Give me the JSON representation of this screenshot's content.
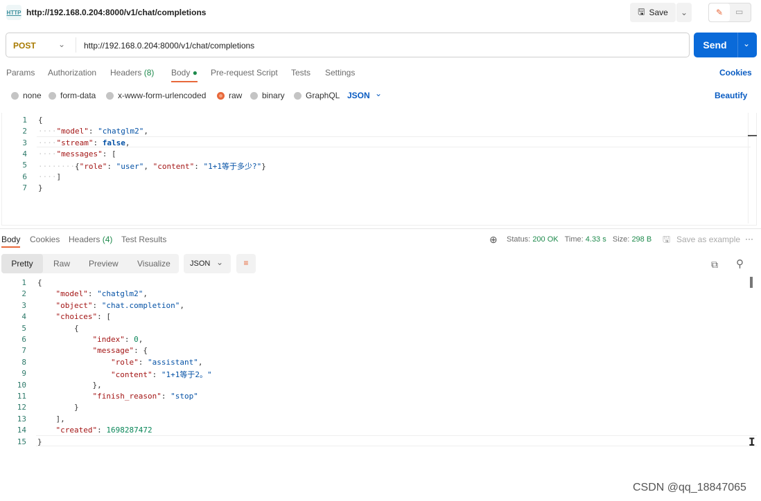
{
  "header": {
    "title": "http://192.168.0.204:8000/v1/chat/completions",
    "icon": "http-icon",
    "save_label": "Save"
  },
  "request": {
    "method": "POST",
    "url": "http://192.168.0.204:8000/v1/chat/completions",
    "send_label": "Send",
    "tabs": [
      {
        "label": "Params"
      },
      {
        "label": "Authorization"
      },
      {
        "label": "Headers",
        "count": "(8)"
      },
      {
        "label": "Body"
      },
      {
        "label": "Pre-request Script"
      },
      {
        "label": "Tests"
      },
      {
        "label": "Settings"
      }
    ],
    "cookies_label": "Cookies",
    "body_types": [
      "none",
      "form-data",
      "x-www-form-urlencoded",
      "raw",
      "binary",
      "GraphQL"
    ],
    "selected_body_type": "raw",
    "format": "JSON",
    "beautify_label": "Beautify",
    "code": [
      [
        [
          "p",
          "{"
        ]
      ],
      [
        [
          "w",
          "····"
        ],
        [
          "k",
          "\"model\""
        ],
        [
          "p",
          ": "
        ],
        [
          "s",
          "\"chatglm2\""
        ],
        [
          "p",
          ","
        ]
      ],
      [
        [
          "w",
          "····"
        ],
        [
          "k",
          "\"stream\""
        ],
        [
          "p",
          ": "
        ],
        [
          "b",
          "false"
        ],
        [
          "p",
          ","
        ]
      ],
      [
        [
          "w",
          "····"
        ],
        [
          "k",
          "\"messages\""
        ],
        [
          "p",
          ": ["
        ]
      ],
      [
        [
          "w",
          "········"
        ],
        [
          "p",
          "{"
        ],
        [
          "k",
          "\"role\""
        ],
        [
          "p",
          ": "
        ],
        [
          "s",
          "\"user\""
        ],
        [
          "p",
          ", "
        ],
        [
          "k",
          "\"content\""
        ],
        [
          "p",
          ": "
        ],
        [
          "s",
          "\"1+1等于多少?\""
        ],
        [
          "p",
          "}"
        ]
      ],
      [
        [
          "w",
          "····"
        ],
        [
          "p",
          "]"
        ]
      ],
      [
        [
          "p",
          "}"
        ]
      ]
    ]
  },
  "response": {
    "tabs": [
      {
        "label": "Body"
      },
      {
        "label": "Cookies"
      },
      {
        "label": "Headers",
        "count": "(4)"
      },
      {
        "label": "Test Results"
      }
    ],
    "status_label": "Status:",
    "status": "200 OK",
    "time_label": "Time:",
    "time": "4.33 s",
    "size_label": "Size:",
    "size": "298 B",
    "save_example": "Save as example",
    "views": [
      "Pretty",
      "Raw",
      "Preview",
      "Visualize"
    ],
    "format": "JSON",
    "status_color": "#1e8a4c",
    "code": [
      [
        [
          "p",
          "{"
        ]
      ],
      [
        [
          "w",
          "    "
        ],
        [
          "k",
          "\"model\""
        ],
        [
          "p",
          ": "
        ],
        [
          "s",
          "\"chatglm2\""
        ],
        [
          "p",
          ","
        ]
      ],
      [
        [
          "w",
          "    "
        ],
        [
          "k",
          "\"object\""
        ],
        [
          "p",
          ": "
        ],
        [
          "s",
          "\"chat.completion\""
        ],
        [
          "p",
          ","
        ]
      ],
      [
        [
          "w",
          "    "
        ],
        [
          "k",
          "\"choices\""
        ],
        [
          "p",
          ": ["
        ]
      ],
      [
        [
          "w",
          "        "
        ],
        [
          "p",
          "{"
        ]
      ],
      [
        [
          "w",
          "            "
        ],
        [
          "k",
          "\"index\""
        ],
        [
          "p",
          ": "
        ],
        [
          "n",
          "0"
        ],
        [
          "p",
          ","
        ]
      ],
      [
        [
          "w",
          "            "
        ],
        [
          "k",
          "\"message\""
        ],
        [
          "p",
          ": {"
        ]
      ],
      [
        [
          "w",
          "                "
        ],
        [
          "k",
          "\"role\""
        ],
        [
          "p",
          ": "
        ],
        [
          "s",
          "\"assistant\""
        ],
        [
          "p",
          ","
        ]
      ],
      [
        [
          "w",
          "                "
        ],
        [
          "k",
          "\"content\""
        ],
        [
          "p",
          ": "
        ],
        [
          "s",
          "\"1+1等于2。\""
        ]
      ],
      [
        [
          "w",
          "            "
        ],
        [
          "p",
          "},"
        ]
      ],
      [
        [
          "w",
          "            "
        ],
        [
          "k",
          "\"finish_reason\""
        ],
        [
          "p",
          ": "
        ],
        [
          "s",
          "\"stop\""
        ]
      ],
      [
        [
          "w",
          "        "
        ],
        [
          "p",
          "}"
        ]
      ],
      [
        [
          "w",
          "    "
        ],
        [
          "p",
          "],"
        ]
      ],
      [
        [
          "w",
          "    "
        ],
        [
          "k",
          "\"created\""
        ],
        [
          "p",
          ": "
        ],
        [
          "n",
          "1698287472"
        ]
      ],
      [
        [
          "p",
          "}"
        ]
      ]
    ]
  },
  "watermark": "CSDN @qq_18847065"
}
